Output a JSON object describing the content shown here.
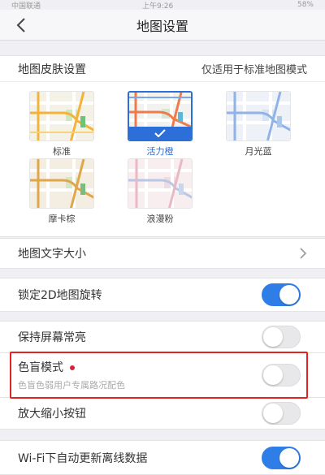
{
  "status": {
    "carrier": "中国联通",
    "time": "上午9:26",
    "battery": "58%"
  },
  "nav": {
    "title": "地图设置"
  },
  "skin": {
    "title": "地图皮肤设置",
    "note": "仅适用于标准地图模式",
    "items": [
      {
        "label": "标准",
        "selected": false,
        "palette": "standard"
      },
      {
        "label": "活力橙",
        "selected": true,
        "palette": "orange"
      },
      {
        "label": "月光蓝",
        "selected": false,
        "palette": "blue"
      },
      {
        "label": "摩卡棕",
        "selected": false,
        "palette": "brown"
      },
      {
        "label": "浪漫粉",
        "selected": false,
        "palette": "pink"
      }
    ]
  },
  "rows": {
    "text_size": {
      "label": "地图文字大小"
    },
    "lock_2d": {
      "label": "锁定2D地图旋转",
      "on": true
    },
    "keep_screen": {
      "label": "保持屏幕常亮",
      "on": false
    },
    "colorblind": {
      "label": "色盲模式",
      "sub": "色盲色弱用户专属路况配色",
      "on": false
    },
    "zoom_btn": {
      "label": "放大缩小按钮",
      "on": false
    },
    "wifi_update": {
      "label": "Wi-Fi下自动更新离线数据",
      "on": true
    }
  },
  "colors": {
    "accent": "#2f7ee8",
    "highlight": "#e52222"
  }
}
